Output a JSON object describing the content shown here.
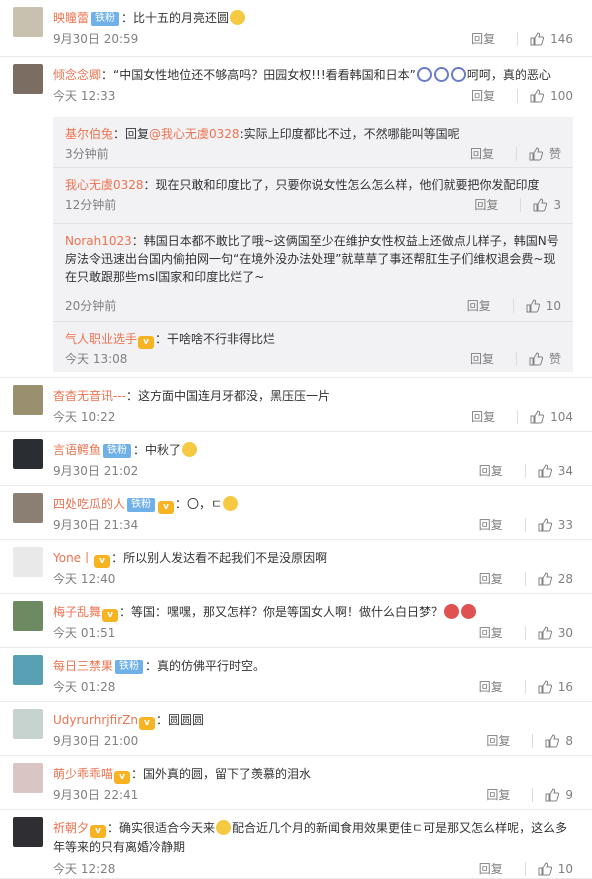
{
  "comments": [
    {
      "user": "映瞳蕾",
      "badge": "铁粉",
      "vip": false,
      "text": "：比十五的月亮还圆",
      "emoji": 1,
      "time": "9月30日 20:59",
      "reply": "回复",
      "likes": "146",
      "avatar": "#c9c1b0"
    },
    {
      "user": "倾念念卿",
      "badge": "",
      "vip": false,
      "text": "：“中国女性地位还不够高吗？田园女权!!!看看韩国和日本”",
      "emoji_after": "呵呵，真的恶心",
      "time": "今天 12:33",
      "reply": "回复",
      "likes": "100",
      "avatar": "#7b6d61"
    },
    {
      "user": "杳杳无音讯---",
      "badge": "",
      "vip": false,
      "text": "：这方面中国连月牙都没，黑压压一片",
      "time": "今天 10:22",
      "reply": "回复",
      "likes": "104",
      "avatar": "#9a8f6e"
    },
    {
      "user": "言语鳄鱼",
      "badge": "铁粉",
      "vip": false,
      "text": "：中秋了",
      "emoji": 1,
      "time": "9月30日 21:02",
      "reply": "回复",
      "likes": "34",
      "avatar": "#2a2d31"
    },
    {
      "user": "四处吃瓜的人",
      "badge": "铁粉",
      "vip": true,
      "text": "：〇，ㄷ",
      "emoji": 1,
      "time": "9月30日 21:34",
      "reply": "回复",
      "likes": "33",
      "avatar": "#8b7f73"
    },
    {
      "user": "Yone丨",
      "badge": "",
      "vip": true,
      "text": "：所以别人发达看不起我们不是没原因啊",
      "time": "今天 12:40",
      "reply": "回复",
      "likes": "28",
      "avatar": "#e9e9e9"
    },
    {
      "user": "梅子乱舞",
      "badge": "",
      "vip": true,
      "text": "：等国：嘿嘿，那又怎样？你是等国女人啊！做什么白日梦？",
      "emoji": 2,
      "time": "今天 01:51",
      "reply": "回复",
      "likes": "30",
      "avatar": "#6e8a63"
    },
    {
      "user": "每日三禁果",
      "badge": "铁粉",
      "vip": false,
      "text": "：真的仿佛平行时空。",
      "time": "今天 01:28",
      "reply": "回复",
      "likes": "16",
      "avatar": "#5aa0b5"
    },
    {
      "user": "UdyrurhrjfirZn",
      "badge": "",
      "vip": true,
      "text": "：圆圆圆",
      "time": "9月30日 21:00",
      "reply": "回复",
      "likes": "8",
      "avatar": "#c7d3cf"
    },
    {
      "user": "萌少乖乖喵",
      "badge": "",
      "vip": true,
      "text": "：国外真的圆，留下了羡慕的泪水",
      "time": "9月30日 22:41",
      "reply": "回复",
      "likes": "9",
      "avatar": "#d9c6c4"
    },
    {
      "user": "祈朝夕",
      "badge": "",
      "vip": true,
      "text": "：确实很适合今天来",
      "text2": "配合近几个月的新闻食用效果更佳ㄷ可是那又怎么样呢，这么多年等来的只有离婚冷静期",
      "time": "今天 12:28",
      "reply": "回复",
      "likes": "10",
      "avatar": "#2f2f33"
    }
  ],
  "subreplies": [
    {
      "user": "基尔伯兔",
      "vip": false,
      "text_pre": "：回复",
      "mention": "@我心无虞0328",
      "text": ":实际上印度都比不过，不然哪能叫等国呢",
      "time": "3分钟前",
      "reply": "回复",
      "likes": "赞"
    },
    {
      "user": "我心无虞0328",
      "vip": false,
      "text_pre": "",
      "mention": "",
      "text": "：现在只敢和印度比了，只要你说女性怎么怎么样，他们就要把你发配印度",
      "time": "12分钟前",
      "reply": "回复",
      "likes": "3"
    },
    {
      "user": "Norah1023",
      "vip": false,
      "text_pre": "",
      "mention": "",
      "text": "：韩国日本都不敢比了哦~这俩国至少在维护女性权益上还做点儿样子，韩国N号房法令迅速出台国内偷拍网一句“在境外没办法处理”就草草了事还帮肛生子们维权退会费~现在只敢跟那些msl国家和印度比烂了~",
      "time": "20分钟前",
      "reply": "回复",
      "likes": "10"
    },
    {
      "user": "气人职业选手",
      "vip": true,
      "text_pre": "",
      "mention": "",
      "text": "：干啥啥不行非得比烂",
      "time": "今天 13:08",
      "reply": "回复",
      "likes": "赞"
    }
  ]
}
